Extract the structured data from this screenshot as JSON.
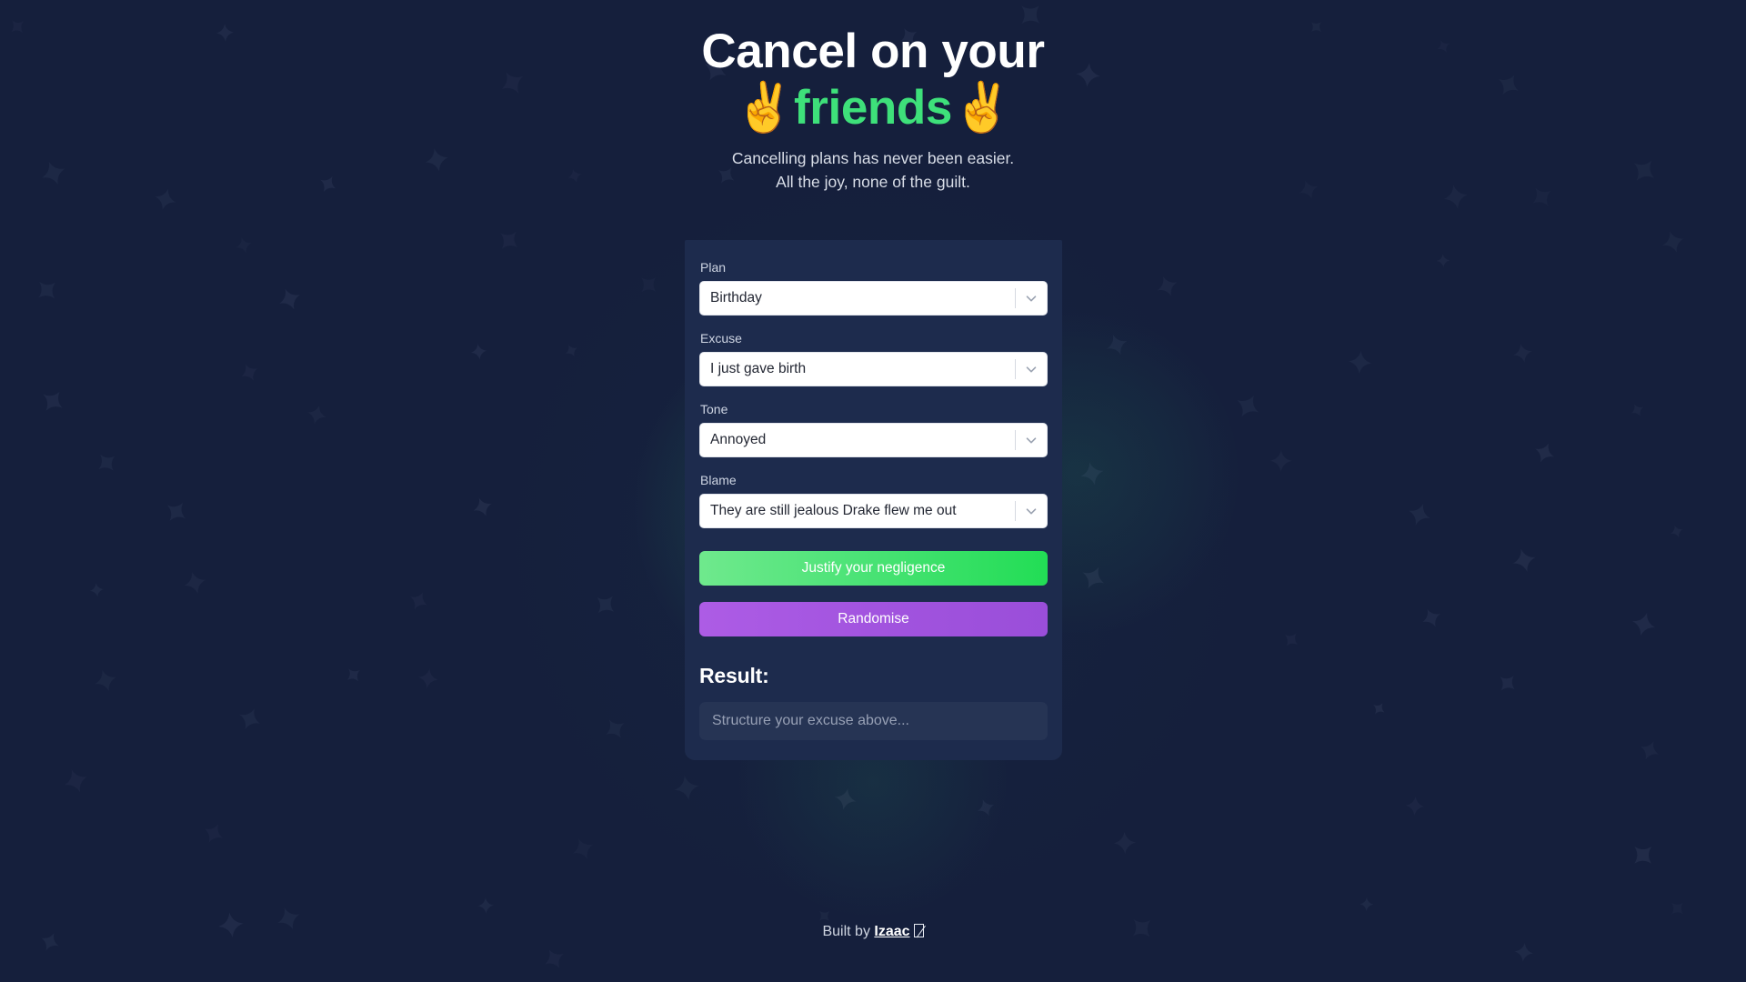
{
  "hero": {
    "title_line1": "Cancel on your",
    "emoji_left": "✌️",
    "title_accent": "friends",
    "emoji_right": "✌️",
    "subtitle_line1": "Cancelling plans has never been easier.",
    "subtitle_line2": "All the joy, none of the guilt."
  },
  "form": {
    "fields": [
      {
        "label": "Plan",
        "value": "Birthday"
      },
      {
        "label": "Excuse",
        "value": "I just gave birth"
      },
      {
        "label": "Tone",
        "value": "Annoyed"
      },
      {
        "label": "Blame",
        "value": "They are still jealous Drake flew me out"
      }
    ],
    "generate_label": "Justify your negligence",
    "randomise_label": "Randomise"
  },
  "result": {
    "heading": "Result:",
    "placeholder": "Structure your excuse above..."
  },
  "footer": {
    "built_by": "Built by",
    "author": "Izaac"
  },
  "colors": {
    "page_background": "#151f3c",
    "card_background": "#1d2b4d",
    "accent_green": "#3ee07a",
    "button_green_from": "#6fe98d",
    "button_green_to": "#22dd55",
    "button_purple_from": "#ad5ce5",
    "button_purple_to": "#9a4ed9",
    "glow_green": "#34be78"
  },
  "icons": {
    "select_chevron": "chevron-down-icon",
    "sparkle": "sparkle-icon",
    "footer_glyph": "missing-glyph-box"
  }
}
